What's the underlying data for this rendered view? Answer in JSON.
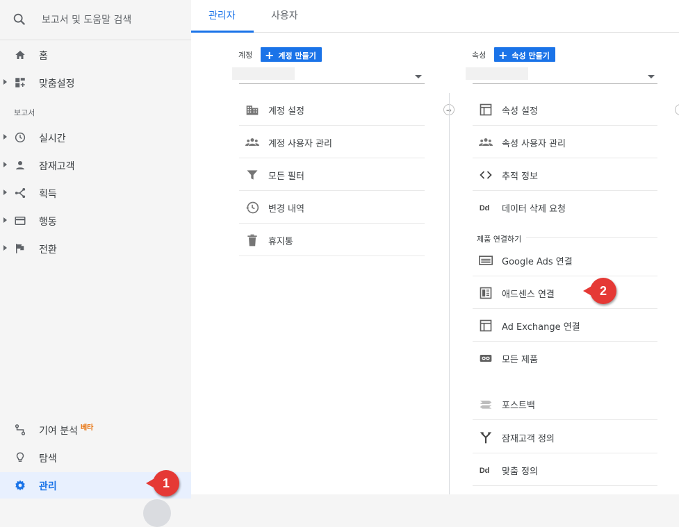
{
  "sidebar": {
    "search_placeholder": "보고서 및 도움말 검색",
    "items_top": [
      {
        "label": "홈"
      },
      {
        "label": "맞춤설정"
      }
    ],
    "section_title": "보고서",
    "report_items": [
      {
        "label": "실시간"
      },
      {
        "label": "잠재고객"
      },
      {
        "label": "획득"
      },
      {
        "label": "행동"
      },
      {
        "label": "전환"
      }
    ],
    "bottom_items": [
      {
        "label": "기여 분석",
        "badge": "베타"
      },
      {
        "label": "탐색"
      },
      {
        "label": "관리"
      }
    ]
  },
  "tabs": [
    {
      "label": "관리자",
      "active": true
    },
    {
      "label": "사용자",
      "active": false
    }
  ],
  "account_column": {
    "heading": "계정",
    "create_button": "계정 만들기",
    "items": [
      {
        "label": "계정 설정",
        "icon": "building-icon"
      },
      {
        "label": "계정 사용자 관리",
        "icon": "people-icon"
      },
      {
        "label": "모든 필터",
        "icon": "filter-icon"
      },
      {
        "label": "변경 내역",
        "icon": "history-icon"
      },
      {
        "label": "휴지통",
        "icon": "trash-icon"
      }
    ]
  },
  "property_column": {
    "heading": "속성",
    "create_button": "속성 만들기",
    "items": [
      {
        "label": "속성 설정",
        "icon": "window-icon"
      },
      {
        "label": "속성 사용자 관리",
        "icon": "people-icon"
      },
      {
        "label": "추적 정보",
        "icon": "code-icon"
      },
      {
        "label": "데이터 삭제 요청",
        "icon": "dd-icon"
      }
    ],
    "product_links_heading": "제품 연결하기",
    "product_links": [
      {
        "label": "Google Ads 연결",
        "icon": "ads-icon"
      },
      {
        "label": "애드센스 연결",
        "icon": "adsense-icon"
      },
      {
        "label": "Ad Exchange 연결",
        "icon": "window-icon"
      },
      {
        "label": "모든 제품",
        "icon": "link-icon"
      }
    ],
    "more_items": [
      {
        "label": "포스트백",
        "icon": "postback-icon"
      },
      {
        "label": "잠재고객 정의",
        "icon": "fork-icon"
      },
      {
        "label": "맞춤 정의",
        "icon": "dd-icon"
      }
    ]
  },
  "callouts": [
    "1",
    "2"
  ],
  "colors": {
    "accent": "#1a73e8",
    "callout": "#e53935",
    "beta": "#e8710a"
  }
}
